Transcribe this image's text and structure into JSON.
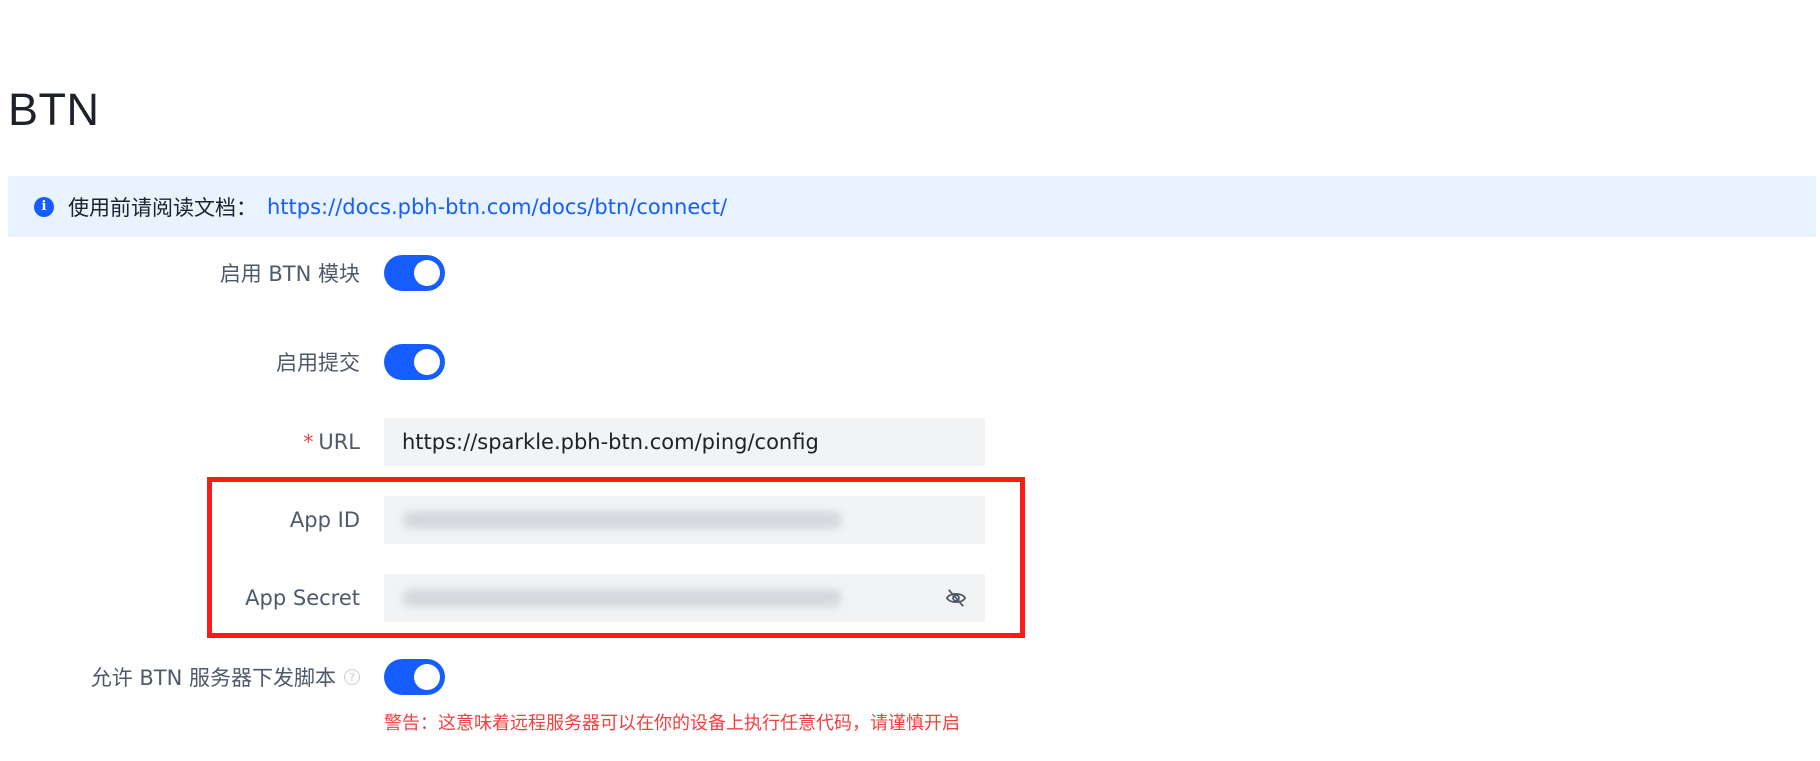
{
  "page": {
    "title": "BTN"
  },
  "alert": {
    "icon": "info-icon",
    "text": "使用前请阅读文档：",
    "link": "https://docs.pbh-btn.com/docs/btn/connect/"
  },
  "form": {
    "enable_module": {
      "label": "启用 BTN 模块",
      "checked": true
    },
    "enable_submit": {
      "label": "启用提交",
      "checked": true
    },
    "url": {
      "label": "URL",
      "required_mark": "*",
      "value": "https://sparkle.pbh-btn.com/ping/config"
    },
    "app_id": {
      "label": "App ID"
    },
    "app_secret": {
      "label": "App Secret",
      "icon": "eye-off-icon"
    },
    "allow_scripts": {
      "label": "允许 BTN 服务器下发脚本",
      "help_icon": "question-circle-icon",
      "checked": true,
      "warning": "警告：这意味着远程服务器可以在你的设备上执行任意代码，请谨慎开启"
    }
  },
  "colors": {
    "primary": "#165dff",
    "alert_bg": "#e8f3ff",
    "danger": "#f53f3f",
    "highlight_border": "#ff1a1a"
  }
}
